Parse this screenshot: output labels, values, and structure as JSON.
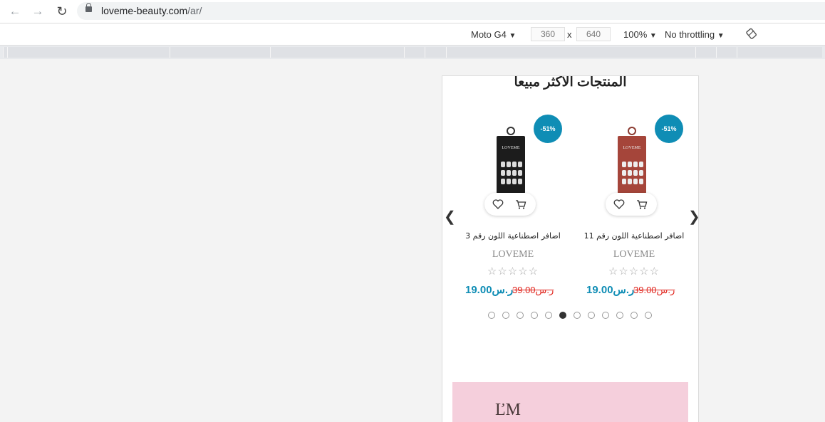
{
  "browser": {
    "url_host": "loveme-beauty.com",
    "url_path": "/ar/"
  },
  "devtools": {
    "device": "Moto G4",
    "width": "360",
    "height": "640",
    "times": "x",
    "zoom": "100%",
    "throttle": "No throttling"
  },
  "section": {
    "title": "المنتجات الاكثر مبيعا"
  },
  "products": [
    {
      "badge": "-51%",
      "name": "اضافر اصطناعية اللون رقم 11",
      "brand": "LOVEME",
      "stars": "☆☆☆☆☆",
      "price_new": "19.00ر.س",
      "price_old": "39.00ر.س",
      "box_color": "#a5453a",
      "image_label": "LOVEME"
    },
    {
      "badge": "-51%",
      "name": "اضافر اصطناعية اللون رقم 3",
      "brand": "LOVEME",
      "stars": "☆☆☆☆☆",
      "price_new": "19.00ر.س",
      "price_old": "39.00ر.س",
      "box_color": "#1c1c1c",
      "image_label": "LOVEME"
    }
  ],
  "carousel": {
    "dot_count": 12,
    "active_index": 5
  },
  "banner": {
    "color": "#f5cfdc"
  },
  "colors": {
    "accent": "#0f8db5",
    "sale": "#e0241c"
  }
}
